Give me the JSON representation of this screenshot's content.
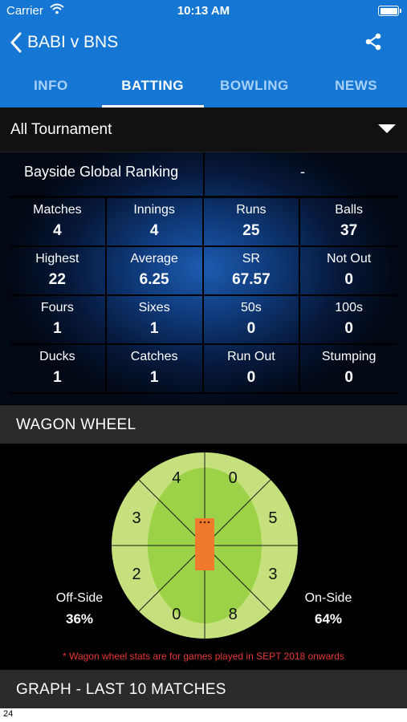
{
  "status": {
    "carrier": "Carrier",
    "time": "10:13 AM"
  },
  "nav": {
    "title": "BABI v BNS"
  },
  "tabs": [
    {
      "label": "INFO"
    },
    {
      "label": "BATTING",
      "active": true
    },
    {
      "label": "BOWLING"
    },
    {
      "label": "NEWS"
    }
  ],
  "filter": {
    "selected": "All Tournament"
  },
  "ranking": {
    "label": "Bayside Global Ranking",
    "value": "-"
  },
  "stats": [
    {
      "label": "Matches",
      "value": "4"
    },
    {
      "label": "Innings",
      "value": "4"
    },
    {
      "label": "Runs",
      "value": "25"
    },
    {
      "label": "Balls",
      "value": "37"
    },
    {
      "label": "Highest",
      "value": "22"
    },
    {
      "label": "Average",
      "value": "6.25"
    },
    {
      "label": "SR",
      "value": "67.57"
    },
    {
      "label": "Not Out",
      "value": "0"
    },
    {
      "label": "Fours",
      "value": "1"
    },
    {
      "label": "Sixes",
      "value": "1"
    },
    {
      "label": "50s",
      "value": "0"
    },
    {
      "label": "100s",
      "value": "0"
    },
    {
      "label": "Ducks",
      "value": "1"
    },
    {
      "label": "Catches",
      "value": "1"
    },
    {
      "label": "Run Out",
      "value": "0"
    },
    {
      "label": "Stumping",
      "value": "0"
    }
  ],
  "wagon": {
    "header": "WAGON WHEEL",
    "sectors": [
      "4",
      "0",
      "5",
      "3",
      "8",
      "0",
      "2",
      "3"
    ],
    "off_side": {
      "label": "Off-Side",
      "value": "36%"
    },
    "on_side": {
      "label": "On-Side",
      "value": "64%"
    },
    "note": "* Wagon wheel stats are for games played in SEPT 2018 onwards"
  },
  "graph": {
    "header": "GRAPH - LAST 10 MATCHES",
    "first_tick": "24"
  },
  "colors": {
    "primary": "#1577d3",
    "field_outer": "#c5e07c",
    "field_inner": "#9cd247",
    "pitch": "#f07a2c",
    "note": "#e53935"
  }
}
